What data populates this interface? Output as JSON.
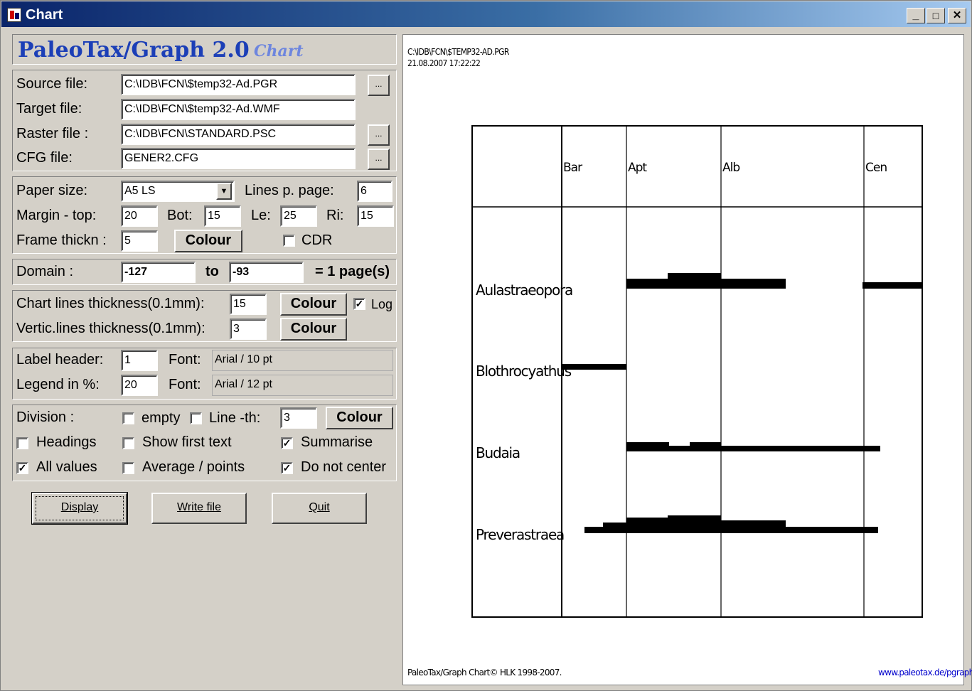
{
  "window": {
    "title": "Chart",
    "min": "_",
    "max": "□",
    "close": "✕"
  },
  "app": {
    "name": "PaleoTax/Graph 2.0",
    "sub": "Chart"
  },
  "files": {
    "source_label": "Source file:",
    "source_value": "C:\\IDB\\FCN\\$temp32-Ad.PGR",
    "target_label": "Target file:",
    "target_value": "C:\\IDB\\FCN\\$temp32-Ad.WMF",
    "raster_label": "Raster file :",
    "raster_value": "C:\\IDB\\FCN\\STANDARD.PSC",
    "cfg_label": "CFG file:",
    "cfg_value": "GENER2.CFG",
    "browse": "..."
  },
  "page": {
    "paper_label": "Paper size:",
    "paper_value": "A5 LS",
    "lines_label": "Lines p. page:",
    "lines_value": "6",
    "margin_label": "Margin - top:",
    "margin_top": "20",
    "bot_label": "Bot:",
    "bot_value": "15",
    "le_label": "Le:",
    "le_value": "25",
    "ri_label": "Ri:",
    "ri_value": "15",
    "frame_label": "Frame thickn :",
    "frame_value": "5",
    "colour": "Colour",
    "cdr_label": "CDR"
  },
  "domain": {
    "label": "Domain :",
    "from": "-127",
    "to_label": "to",
    "to": "-93",
    "pages": "= 1 page(s)"
  },
  "lines": {
    "chart_label": "Chart lines  thickness(0.1mm):",
    "chart_value": "15",
    "vert_label": "Vertic.lines thickness(0.1mm):",
    "vert_value": "3",
    "colour": "Colour",
    "log_label": "Log",
    "log_checked": "✓"
  },
  "labels": {
    "header_label": "Label header:",
    "header_value": "1",
    "legend_label": "Legend in %:",
    "legend_value": "20",
    "font_label": "Font:",
    "font1": "Arial / 10 pt",
    "font2": "Arial / 12 pt"
  },
  "division": {
    "label": "Division :",
    "empty_label": "empty",
    "lineth_label": "Line -th:",
    "lineth_value": "3",
    "colour": "Colour",
    "headings": "Headings",
    "show_first": "Show first text",
    "summarise": "Summarise",
    "all_values": "All values",
    "average": "Average / points",
    "not_center": "Do not center",
    "check": "✓"
  },
  "actions": {
    "display": "Display",
    "write": "Write file",
    "quit": "Quit"
  },
  "preview": {
    "path": "C:\\IDB\\FCN\\$TEMP32-AD.PGR",
    "timestamp": "21.08.2007 17:22:22",
    "footer_left": "PaleoTax/Graph Chart© HLK 1998-2007.",
    "footer_right": "www.paleotax.de/pgraph"
  },
  "chart_data": {
    "type": "range",
    "stages": [
      "Bar",
      "Apt",
      "Alb",
      "Cen"
    ],
    "taxa": [
      "Aulastraeopora",
      "Blothrocyathus",
      "Budaia",
      "Preverastraea"
    ]
  },
  "colors": {
    "title_blue": "#1c3fb7",
    "sub_blue": "#6e86de",
    "link_blue": "#0000cc"
  }
}
